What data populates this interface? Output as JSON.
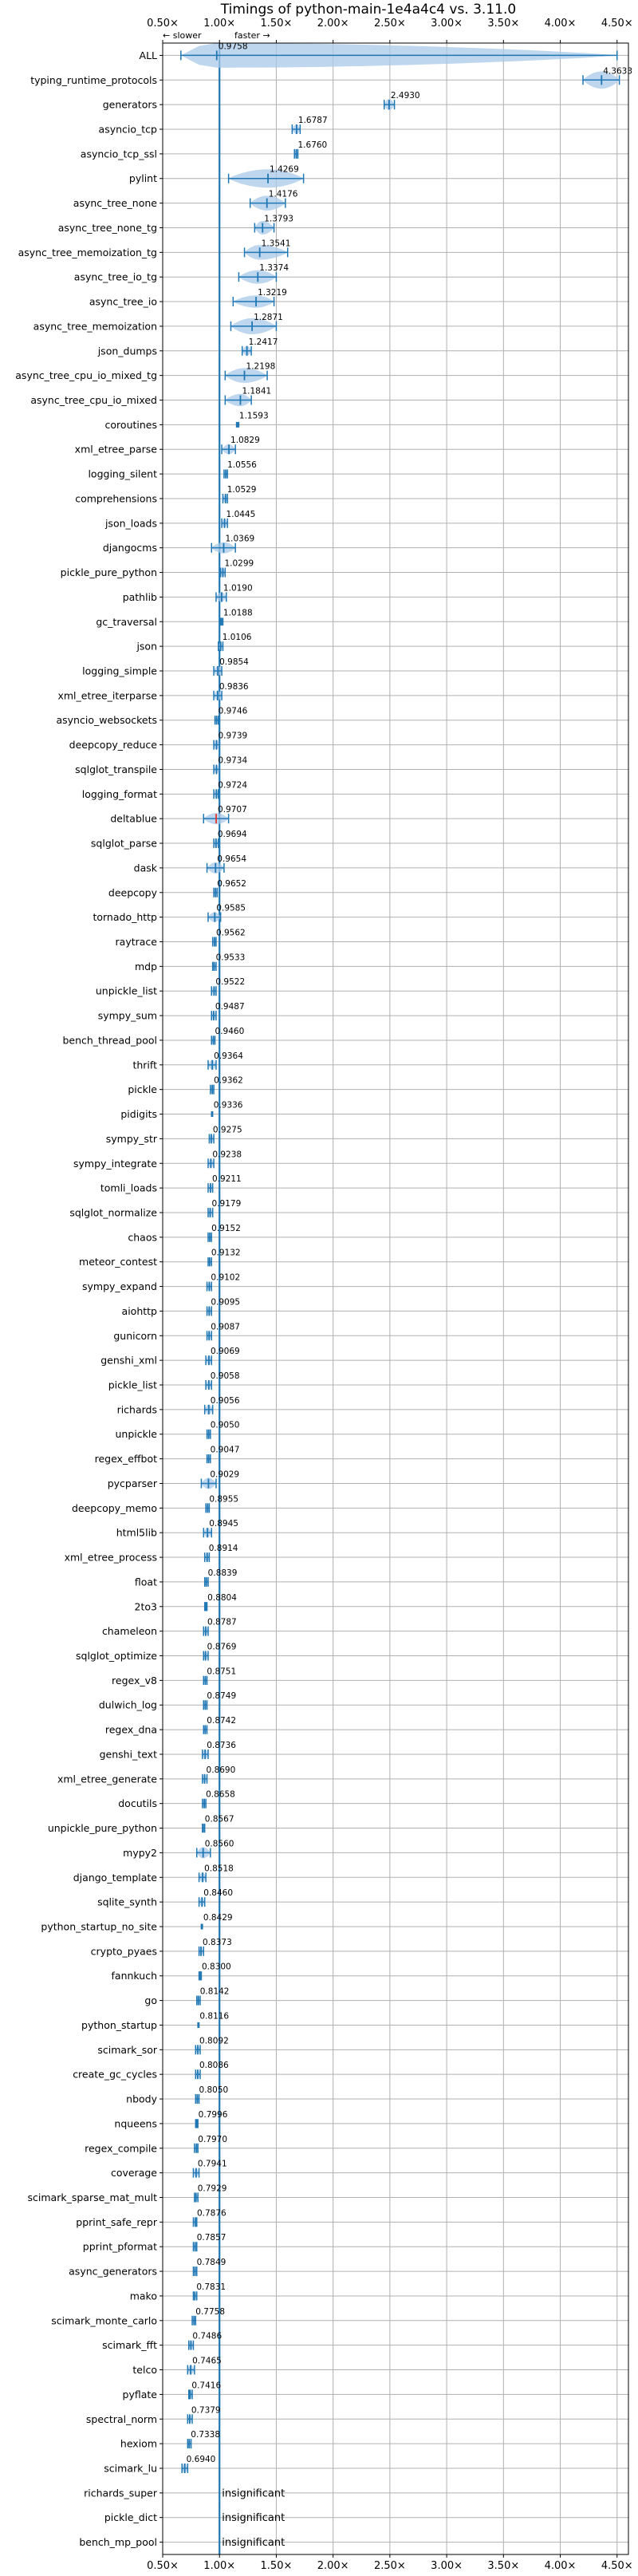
{
  "chart_data": {
    "type": "violin",
    "title": "Timings of python-main-1e4a4c4 vs. 3.11.0",
    "direction_note": {
      "slower": "← slower",
      "faster": "faster →"
    },
    "xlim": [
      0.5,
      4.6
    ],
    "xticks": [
      0.5,
      1.0,
      1.5,
      2.0,
      2.5,
      3.0,
      3.5,
      4.0,
      4.5
    ],
    "xtick_labels": [
      "0.50×",
      "1.00×",
      "1.50×",
      "2.00×",
      "2.50×",
      "3.00×",
      "3.50×",
      "4.00×",
      "4.50×"
    ],
    "reference_line": 1.0,
    "grid": true,
    "colors": {
      "violin": "#a8c8e8",
      "line": "#1f77b4",
      "reference": "#1f77b4",
      "highlight": "#e3342f"
    },
    "insignificant_text": "insignificant",
    "benchmarks": [
      {
        "name": "ALL",
        "value": 0.9758,
        "label": "0.9758",
        "min": 0.66,
        "max": 4.5,
        "width": 1.0
      },
      {
        "name": "typing_runtime_protocols",
        "value": 4.3633,
        "label": "4.3633",
        "min": 4.2,
        "max": 4.52,
        "width": 0.7
      },
      {
        "name": "generators",
        "value": 2.493,
        "label": "2.4930",
        "min": 2.45,
        "max": 2.54,
        "width": 0.45
      },
      {
        "name": "asyncio_tcp",
        "value": 1.6787,
        "label": "1.6787",
        "min": 1.64,
        "max": 1.71,
        "width": 0.4
      },
      {
        "name": "asyncio_tcp_ssl",
        "value": 1.676,
        "label": "1.6760",
        "min": 1.66,
        "max": 1.69,
        "width": 0.35
      },
      {
        "name": "pylint",
        "value": 1.4269,
        "label": "1.4269",
        "min": 1.08,
        "max": 1.74,
        "width": 0.75
      },
      {
        "name": "async_tree_none",
        "value": 1.4176,
        "label": "1.4176",
        "min": 1.27,
        "max": 1.58,
        "width": 0.6
      },
      {
        "name": "async_tree_none_tg",
        "value": 1.3793,
        "label": "1.3793",
        "min": 1.31,
        "max": 1.48,
        "width": 0.55
      },
      {
        "name": "async_tree_memoization_tg",
        "value": 1.3541,
        "label": "1.3541",
        "min": 1.22,
        "max": 1.6,
        "width": 0.6
      },
      {
        "name": "async_tree_io_tg",
        "value": 1.3374,
        "label": "1.3374",
        "min": 1.17,
        "max": 1.5,
        "width": 0.55
      },
      {
        "name": "async_tree_io",
        "value": 1.3219,
        "label": "1.3219",
        "min": 1.12,
        "max": 1.48,
        "width": 0.5
      },
      {
        "name": "async_tree_memoization",
        "value": 1.2871,
        "label": "1.2871",
        "min": 1.1,
        "max": 1.5,
        "width": 0.65
      },
      {
        "name": "json_dumps",
        "value": 1.2417,
        "label": "1.2417",
        "min": 1.2,
        "max": 1.28,
        "width": 0.4
      },
      {
        "name": "async_tree_cpu_io_mixed_tg",
        "value": 1.2198,
        "label": "1.2198",
        "min": 1.05,
        "max": 1.42,
        "width": 0.6
      },
      {
        "name": "async_tree_cpu_io_mixed",
        "value": 1.1841,
        "label": "1.1841",
        "min": 1.05,
        "max": 1.28,
        "width": 0.5
      },
      {
        "name": "coroutines",
        "value": 1.1593,
        "label": "1.1593",
        "min": 1.15,
        "max": 1.17,
        "width": 0.15
      },
      {
        "name": "xml_etree_parse",
        "value": 1.0829,
        "label": "1.0829",
        "min": 1.02,
        "max": 1.14,
        "width": 0.4
      },
      {
        "name": "logging_silent",
        "value": 1.0556,
        "label": "1.0556",
        "min": 1.04,
        "max": 1.07,
        "width": 0.3
      },
      {
        "name": "comprehensions",
        "value": 1.0529,
        "label": "1.0529",
        "min": 1.03,
        "max": 1.07,
        "width": 0.35
      },
      {
        "name": "json_loads",
        "value": 1.0445,
        "label": "1.0445",
        "min": 1.02,
        "max": 1.07,
        "width": 0.35
      },
      {
        "name": "djangocms",
        "value": 1.0369,
        "label": "1.0369",
        "min": 0.93,
        "max": 1.14,
        "width": 0.45
      },
      {
        "name": "pickle_pure_python",
        "value": 1.0299,
        "label": "1.0299",
        "min": 1.01,
        "max": 1.05,
        "width": 0.35
      },
      {
        "name": "pathlib",
        "value": 1.019,
        "label": "1.0190",
        "min": 0.97,
        "max": 1.06,
        "width": 0.4
      },
      {
        "name": "gc_traversal",
        "value": 1.0188,
        "label": "1.0188",
        "min": 1.01,
        "max": 1.03,
        "width": 0.25
      },
      {
        "name": "json",
        "value": 1.0106,
        "label": "1.0106",
        "min": 0.99,
        "max": 1.03,
        "width": 0.35
      },
      {
        "name": "logging_simple",
        "value": 0.9854,
        "label": "0.9854",
        "min": 0.95,
        "max": 1.02,
        "width": 0.4
      },
      {
        "name": "xml_etree_iterparse",
        "value": 0.9836,
        "label": "0.9836",
        "min": 0.95,
        "max": 1.02,
        "width": 0.4
      },
      {
        "name": "asyncio_websockets",
        "value": 0.9746,
        "label": "0.9746",
        "min": 0.96,
        "max": 0.99,
        "width": 0.3
      },
      {
        "name": "deepcopy_reduce",
        "value": 0.9739,
        "label": "0.9739",
        "min": 0.95,
        "max": 1.0,
        "width": 0.4
      },
      {
        "name": "sqlglot_transpile",
        "value": 0.9734,
        "label": "0.9734",
        "min": 0.95,
        "max": 1.0,
        "width": 0.35
      },
      {
        "name": "logging_format",
        "value": 0.9724,
        "label": "0.9724",
        "min": 0.95,
        "max": 0.99,
        "width": 0.35
      },
      {
        "name": "deltablue",
        "value": 0.9707,
        "label": "0.9707",
        "min": 0.86,
        "max": 1.08,
        "width": 0.45,
        "highlight": true
      },
      {
        "name": "sqlglot_parse",
        "value": 0.9694,
        "label": "0.9694",
        "min": 0.95,
        "max": 0.99,
        "width": 0.35
      },
      {
        "name": "dask",
        "value": 0.9654,
        "label": "0.9654",
        "min": 0.89,
        "max": 1.04,
        "width": 0.45
      },
      {
        "name": "deepcopy",
        "value": 0.9652,
        "label": "0.9652",
        "min": 0.95,
        "max": 0.98,
        "width": 0.35
      },
      {
        "name": "tornado_http",
        "value": 0.9585,
        "label": "0.9585",
        "min": 0.9,
        "max": 1.01,
        "width": 0.4
      },
      {
        "name": "raytrace",
        "value": 0.9562,
        "label": "0.9562",
        "min": 0.94,
        "max": 0.97,
        "width": 0.35
      },
      {
        "name": "mdp",
        "value": 0.9533,
        "label": "0.9533",
        "min": 0.94,
        "max": 0.97,
        "width": 0.3
      },
      {
        "name": "unpickle_list",
        "value": 0.9522,
        "label": "0.9522",
        "min": 0.93,
        "max": 0.97,
        "width": 0.35
      },
      {
        "name": "sympy_sum",
        "value": 0.9487,
        "label": "0.9487",
        "min": 0.93,
        "max": 0.97,
        "width": 0.35
      },
      {
        "name": "bench_thread_pool",
        "value": 0.946,
        "label": "0.9460",
        "min": 0.93,
        "max": 0.96,
        "width": 0.3
      },
      {
        "name": "thrift",
        "value": 0.9364,
        "label": "0.9364",
        "min": 0.9,
        "max": 0.97,
        "width": 0.4
      },
      {
        "name": "pickle",
        "value": 0.9362,
        "label": "0.9362",
        "min": 0.92,
        "max": 0.95,
        "width": 0.35
      },
      {
        "name": "pidigits",
        "value": 0.9336,
        "label": "0.9336",
        "min": 0.93,
        "max": 0.94,
        "width": 0.15
      },
      {
        "name": "sympy_str",
        "value": 0.9275,
        "label": "0.9275",
        "min": 0.91,
        "max": 0.95,
        "width": 0.35
      },
      {
        "name": "sympy_integrate",
        "value": 0.9238,
        "label": "0.9238",
        "min": 0.9,
        "max": 0.95,
        "width": 0.35
      },
      {
        "name": "tomli_loads",
        "value": 0.9211,
        "label": "0.9211",
        "min": 0.9,
        "max": 0.94,
        "width": 0.35
      },
      {
        "name": "sqlglot_normalize",
        "value": 0.9179,
        "label": "0.9179",
        "min": 0.9,
        "max": 0.94,
        "width": 0.35
      },
      {
        "name": "chaos",
        "value": 0.9152,
        "label": "0.9152",
        "min": 0.9,
        "max": 0.93,
        "width": 0.35
      },
      {
        "name": "meteor_contest",
        "value": 0.9132,
        "label": "0.9132",
        "min": 0.9,
        "max": 0.93,
        "width": 0.3
      },
      {
        "name": "sympy_expand",
        "value": 0.9102,
        "label": "0.9102",
        "min": 0.89,
        "max": 0.93,
        "width": 0.35
      },
      {
        "name": "aiohttp",
        "value": 0.9095,
        "label": "0.9095",
        "min": 0.89,
        "max": 0.93,
        "width": 0.35
      },
      {
        "name": "gunicorn",
        "value": 0.9087,
        "label": "0.9087",
        "min": 0.89,
        "max": 0.93,
        "width": 0.35
      },
      {
        "name": "genshi_xml",
        "value": 0.9069,
        "label": "0.9069",
        "min": 0.88,
        "max": 0.93,
        "width": 0.4
      },
      {
        "name": "pickle_list",
        "value": 0.9058,
        "label": "0.9058",
        "min": 0.88,
        "max": 0.93,
        "width": 0.35
      },
      {
        "name": "richards",
        "value": 0.9056,
        "label": "0.9056",
        "min": 0.87,
        "max": 0.94,
        "width": 0.4
      },
      {
        "name": "unpickle",
        "value": 0.905,
        "label": "0.9050",
        "min": 0.89,
        "max": 0.92,
        "width": 0.35
      },
      {
        "name": "regex_effbot",
        "value": 0.9047,
        "label": "0.9047",
        "min": 0.89,
        "max": 0.92,
        "width": 0.3
      },
      {
        "name": "pycparser",
        "value": 0.9029,
        "label": "0.9029",
        "min": 0.84,
        "max": 0.97,
        "width": 0.45
      },
      {
        "name": "deepcopy_memo",
        "value": 0.8955,
        "label": "0.8955",
        "min": 0.88,
        "max": 0.91,
        "width": 0.35
      },
      {
        "name": "html5lib",
        "value": 0.8945,
        "label": "0.8945",
        "min": 0.86,
        "max": 0.93,
        "width": 0.4
      },
      {
        "name": "xml_etree_process",
        "value": 0.8914,
        "label": "0.8914",
        "min": 0.87,
        "max": 0.91,
        "width": 0.35
      },
      {
        "name": "float",
        "value": 0.8839,
        "label": "0.8839",
        "min": 0.87,
        "max": 0.9,
        "width": 0.35
      },
      {
        "name": "2to3",
        "value": 0.8804,
        "label": "0.8804",
        "min": 0.87,
        "max": 0.89,
        "width": 0.3
      },
      {
        "name": "chameleon",
        "value": 0.8787,
        "label": "0.8787",
        "min": 0.86,
        "max": 0.9,
        "width": 0.35
      },
      {
        "name": "sqlglot_optimize",
        "value": 0.8769,
        "label": "0.8769",
        "min": 0.86,
        "max": 0.9,
        "width": 0.35
      },
      {
        "name": "regex_v8",
        "value": 0.8751,
        "label": "0.8751",
        "min": 0.86,
        "max": 0.89,
        "width": 0.3
      },
      {
        "name": "dulwich_log",
        "value": 0.8749,
        "label": "0.8749",
        "min": 0.86,
        "max": 0.89,
        "width": 0.35
      },
      {
        "name": "regex_dna",
        "value": 0.8742,
        "label": "0.8742",
        "min": 0.86,
        "max": 0.89,
        "width": 0.3
      },
      {
        "name": "genshi_text",
        "value": 0.8736,
        "label": "0.8736",
        "min": 0.85,
        "max": 0.9,
        "width": 0.4
      },
      {
        "name": "xml_etree_generate",
        "value": 0.869,
        "label": "0.8690",
        "min": 0.85,
        "max": 0.89,
        "width": 0.35
      },
      {
        "name": "docutils",
        "value": 0.8658,
        "label": "0.8658",
        "min": 0.85,
        "max": 0.88,
        "width": 0.35
      },
      {
        "name": "unpickle_pure_python",
        "value": 0.8567,
        "label": "0.8567",
        "min": 0.85,
        "max": 0.87,
        "width": 0.3
      },
      {
        "name": "mypy2",
        "value": 0.856,
        "label": "0.8560",
        "min": 0.8,
        "max": 0.92,
        "width": 0.45
      },
      {
        "name": "django_template",
        "value": 0.8518,
        "label": "0.8518",
        "min": 0.82,
        "max": 0.88,
        "width": 0.4
      },
      {
        "name": "sqlite_synth",
        "value": 0.846,
        "label": "0.8460",
        "min": 0.82,
        "max": 0.87,
        "width": 0.35
      },
      {
        "name": "python_startup_no_site",
        "value": 0.8429,
        "label": "0.8429",
        "min": 0.84,
        "max": 0.85,
        "width": 0.15
      },
      {
        "name": "crypto_pyaes",
        "value": 0.8373,
        "label": "0.8373",
        "min": 0.82,
        "max": 0.86,
        "width": 0.35
      },
      {
        "name": "fannkuch",
        "value": 0.83,
        "label": "0.8300",
        "min": 0.82,
        "max": 0.84,
        "width": 0.3
      },
      {
        "name": "go",
        "value": 0.8142,
        "label": "0.8142",
        "min": 0.8,
        "max": 0.83,
        "width": 0.35
      },
      {
        "name": "python_startup",
        "value": 0.8116,
        "label": "0.8116",
        "min": 0.81,
        "max": 0.82,
        "width": 0.15
      },
      {
        "name": "scimark_sor",
        "value": 0.8092,
        "label": "0.8092",
        "min": 0.79,
        "max": 0.83,
        "width": 0.35
      },
      {
        "name": "create_gc_cycles",
        "value": 0.8086,
        "label": "0.8086",
        "min": 0.79,
        "max": 0.83,
        "width": 0.35
      },
      {
        "name": "nbody",
        "value": 0.805,
        "label": "0.8050",
        "min": 0.79,
        "max": 0.82,
        "width": 0.35
      },
      {
        "name": "nqueens",
        "value": 0.7996,
        "label": "0.7996",
        "min": 0.79,
        "max": 0.81,
        "width": 0.3
      },
      {
        "name": "regex_compile",
        "value": 0.797,
        "label": "0.7970",
        "min": 0.78,
        "max": 0.81,
        "width": 0.35
      },
      {
        "name": "coverage",
        "value": 0.7941,
        "label": "0.7941",
        "min": 0.77,
        "max": 0.82,
        "width": 0.35
      },
      {
        "name": "scimark_sparse_mat_mult",
        "value": 0.7929,
        "label": "0.7929",
        "min": 0.78,
        "max": 0.81,
        "width": 0.35
      },
      {
        "name": "pprint_safe_repr",
        "value": 0.7876,
        "label": "0.7876",
        "min": 0.77,
        "max": 0.8,
        "width": 0.35
      },
      {
        "name": "pprint_pformat",
        "value": 0.7857,
        "label": "0.7857",
        "min": 0.77,
        "max": 0.8,
        "width": 0.35
      },
      {
        "name": "async_generators",
        "value": 0.7849,
        "label": "0.7849",
        "min": 0.77,
        "max": 0.8,
        "width": 0.35
      },
      {
        "name": "mako",
        "value": 0.7831,
        "label": "0.7831",
        "min": 0.77,
        "max": 0.8,
        "width": 0.3
      },
      {
        "name": "scimark_monte_carlo",
        "value": 0.7758,
        "label": "0.7758",
        "min": 0.76,
        "max": 0.79,
        "width": 0.35
      },
      {
        "name": "scimark_fft",
        "value": 0.7486,
        "label": "0.7486",
        "min": 0.73,
        "max": 0.77,
        "width": 0.35
      },
      {
        "name": "telco",
        "value": 0.7465,
        "label": "0.7465",
        "min": 0.72,
        "max": 0.78,
        "width": 0.4
      },
      {
        "name": "pyflate",
        "value": 0.7416,
        "label": "0.7416",
        "min": 0.73,
        "max": 0.76,
        "width": 0.35
      },
      {
        "name": "spectral_norm",
        "value": 0.7379,
        "label": "0.7379",
        "min": 0.72,
        "max": 0.76,
        "width": 0.35
      },
      {
        "name": "hexiom",
        "value": 0.7338,
        "label": "0.7338",
        "min": 0.72,
        "max": 0.75,
        "width": 0.35
      },
      {
        "name": "scimark_lu",
        "value": 0.694,
        "label": "0.6940",
        "min": 0.67,
        "max": 0.72,
        "width": 0.4
      },
      {
        "name": "richards_super",
        "value": null,
        "label": "insignificant"
      },
      {
        "name": "pickle_dict",
        "value": null,
        "label": "insignificant"
      },
      {
        "name": "bench_mp_pool",
        "value": null,
        "label": "insignificant"
      }
    ]
  }
}
